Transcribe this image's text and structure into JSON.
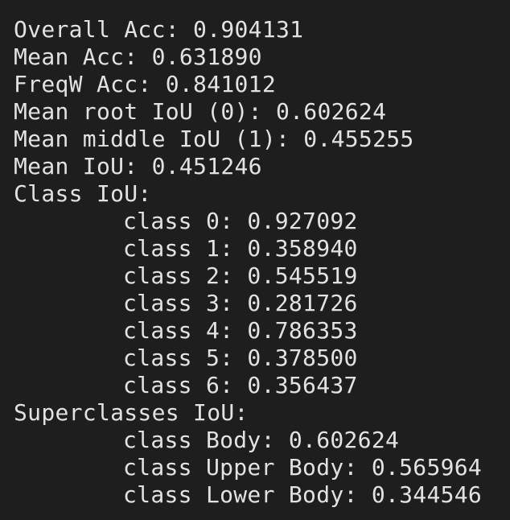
{
  "metrics": {
    "overall_acc": "Overall Acc: 0.904131",
    "mean_acc": "Mean Acc: 0.631890",
    "freqw_acc": "FreqW Acc: 0.841012",
    "mean_root_iou": "Mean root IoU (0): 0.602624",
    "mean_middle_iou": "Mean middle IoU (1): 0.455255",
    "mean_iou": "Mean IoU: 0.451246"
  },
  "class_iou": {
    "header": "Class IoU:",
    "rows": [
      "class 0: 0.927092",
      "class 1: 0.358940",
      "class 2: 0.545519",
      "class 3: 0.281726",
      "class 4: 0.786353",
      "class 5: 0.378500",
      "class 6: 0.356437"
    ]
  },
  "superclass_iou": {
    "header": "Superclasses IoU:",
    "rows": [
      "class Body: 0.602624",
      "class Upper Body: 0.565964",
      "class Lower Body: 0.344546"
    ]
  },
  "colors": {
    "background": "#1e1e1e",
    "text": "#e2e2e2"
  }
}
